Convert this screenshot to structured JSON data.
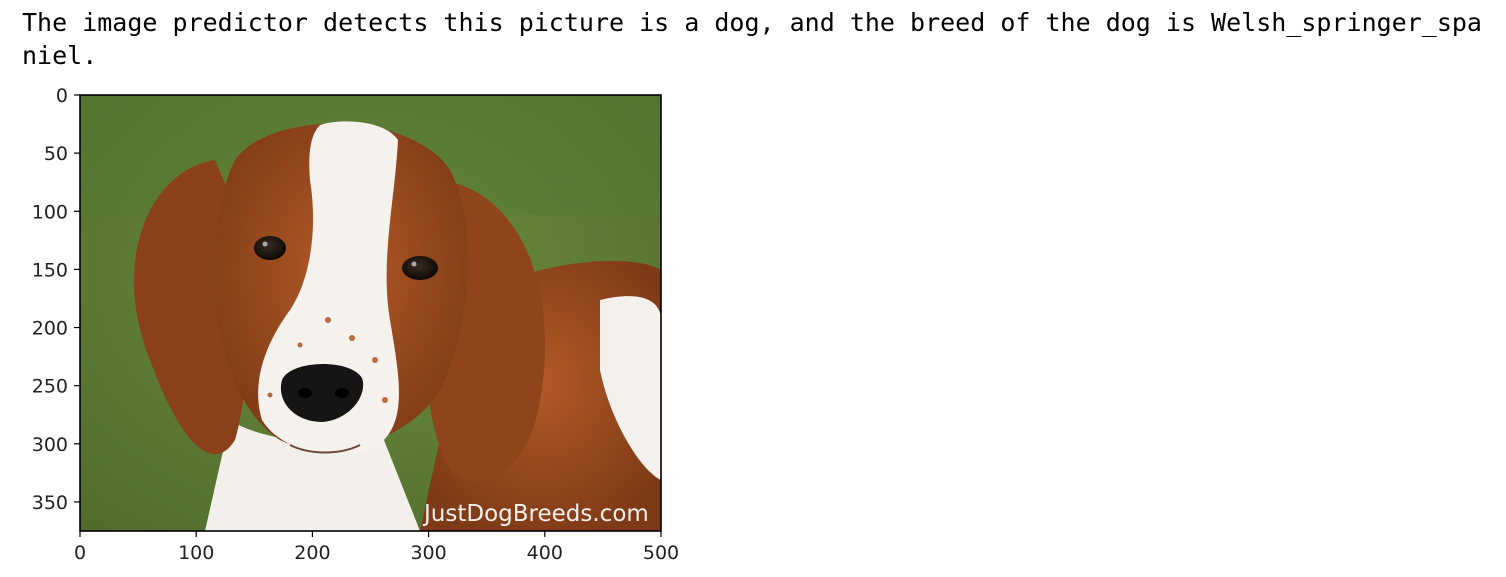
{
  "output": {
    "text": "The image predictor detects this picture is a dog, and the breed of the dog is Welsh_springer_spaniel."
  },
  "image": {
    "watermark": "JustDogBreeds.com",
    "subject": "Welsh springer spaniel puppy on grass"
  },
  "chart_data": {
    "type": "image",
    "x_ticks": [
      0,
      100,
      200,
      300,
      400,
      500
    ],
    "y_ticks": [
      0,
      50,
      100,
      150,
      200,
      250,
      300,
      350
    ],
    "xlim": [
      0,
      500
    ],
    "ylim": [
      375,
      0
    ],
    "grid": false
  },
  "colors": {
    "grass": "#5f7f38",
    "coat": "#9a4a1e",
    "white": "#f7f5f2",
    "nose": "#141414"
  }
}
